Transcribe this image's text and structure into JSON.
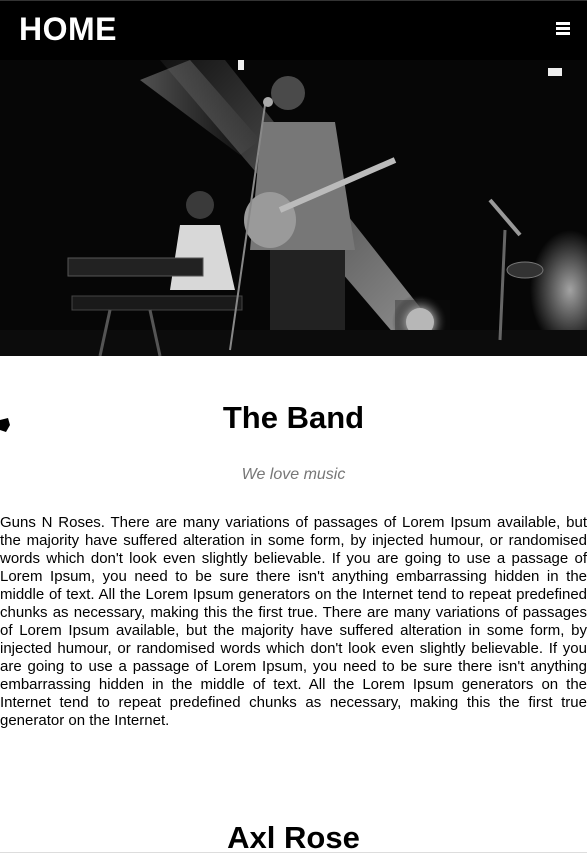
{
  "nav": {
    "home_label": "HOME",
    "menu_icon": "hamburger-menu-icon"
  },
  "hero": {
    "image": "band-on-stage-photo"
  },
  "band": {
    "title": "The Band",
    "tagline": "We love music",
    "description": "Guns N Roses. There are many variations of passages of Lorem Ipsum available, but the majority have suffered alteration in some form, by injected humour, or randomised words which don't look even slightly believable. If you are going to use a passage of Lorem Ipsum, you need to be sure there isn't anything embarrassing hidden in the middle of text. All the Lorem Ipsum generators on the Internet tend to repeat predefined chunks as necessary, making this the first true. There are many variations of passages of Lorem Ipsum available, but the majority have suffered alteration in some form, by injected humour, or randomised words which don't look even slightly believable. If you are going to use a passage of Lorem Ipsum, you need to be sure there isn't anything embarrassing hidden in the middle of text. All the Lorem Ipsum generators on the Internet tend to repeat predefined chunks as necessary, making this the first true generator on the Internet."
  },
  "member": {
    "name": "Axl Rose"
  }
}
